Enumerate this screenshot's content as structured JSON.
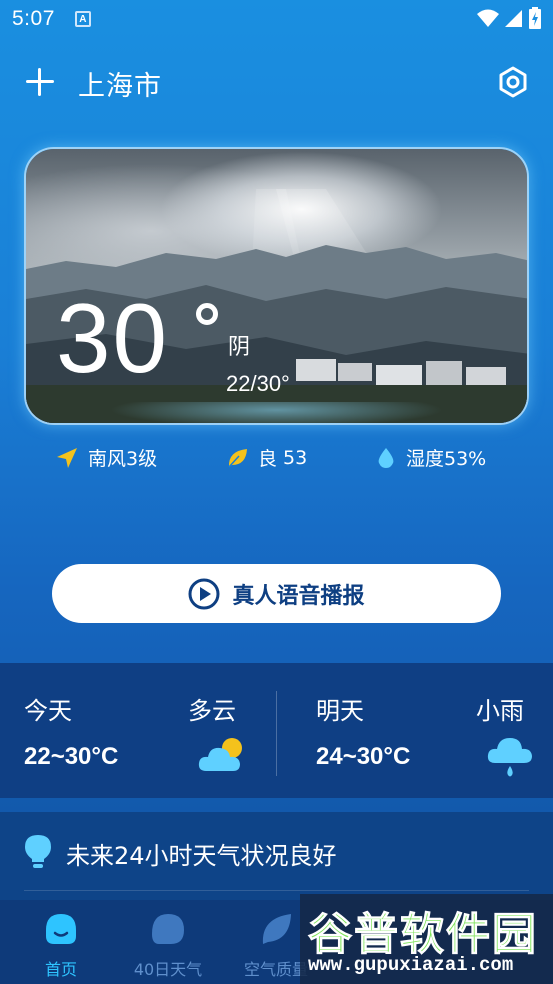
{
  "status_bar": {
    "time": "5:07",
    "app_badge": "A"
  },
  "header": {
    "city": "上海市"
  },
  "current": {
    "temperature": "30",
    "condition": "阴",
    "range": "22/30°"
  },
  "metrics": {
    "wind": "南风3级",
    "aqi_label": "良",
    "aqi_value": "53",
    "humidity": "湿度53%"
  },
  "voice_button": {
    "label": "真人语音播报"
  },
  "forecast": {
    "today": {
      "day": "今天",
      "condition": "多云",
      "temps": "22~30°C"
    },
    "tomorrow": {
      "day": "明天",
      "condition": "小雨",
      "temps": "24~30°C"
    }
  },
  "tip": {
    "text": "未来24小时天气状况良好"
  },
  "nav": {
    "items": [
      {
        "label": "首页",
        "active": true
      },
      {
        "label": "40日天气",
        "active": false
      },
      {
        "label": "空气质量",
        "active": false
      }
    ]
  },
  "watermark": {
    "title": "谷普软件园",
    "url": "www.gupuxiazai.com"
  },
  "colors": {
    "accent": "#2ec4ff",
    "leaf": "#f4c21c",
    "nav_inactive": "#5f8fcc",
    "button_text": "#0e3f82"
  }
}
